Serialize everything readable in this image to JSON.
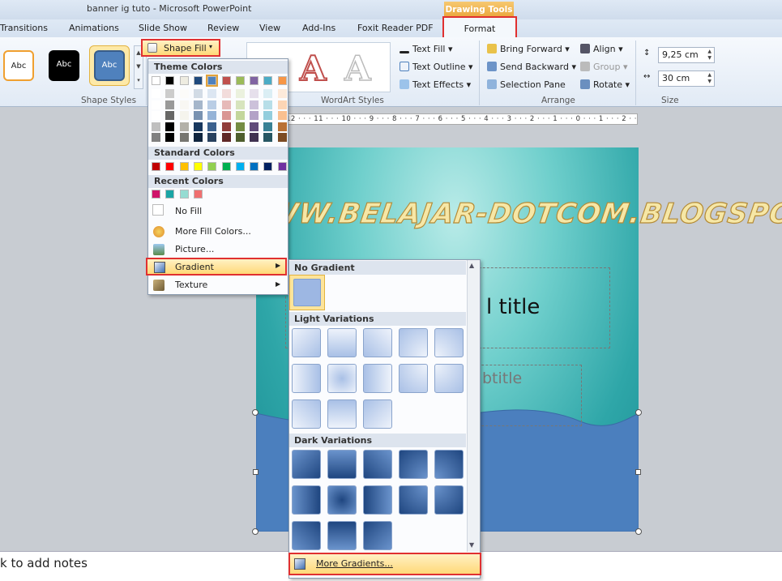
{
  "window": {
    "title": "banner ig tuto  -  Microsoft PowerPoint",
    "contextual_tab": "Drawing Tools"
  },
  "tabs": [
    "Transitions",
    "Animations",
    "Slide Show",
    "Review",
    "View",
    "Add-Ins",
    "Foxit Reader PDF",
    "Format"
  ],
  "ribbon": {
    "shape_styles": {
      "label": "Shape Styles",
      "thumbs": [
        "Abc",
        "Abc",
        "Abc"
      ],
      "shape_fill": "Shape Fill"
    },
    "wordart": {
      "label": "WordArt Styles",
      "text_fill": "Text Fill",
      "text_outline": "Text Outline",
      "text_effects": "Text Effects"
    },
    "arrange": {
      "label": "Arrange",
      "bring_forward": "Bring Forward",
      "send_backward": "Send Backward",
      "selection_pane": "Selection Pane",
      "align": "Align",
      "group": "Group",
      "rotate": "Rotate"
    },
    "size": {
      "label": "Size",
      "height": "9,25 cm",
      "width": "30 cm"
    }
  },
  "ruler": "12 · · · 11 · · · 10 · · · 9 · · · 8 · · · 7 · · · 6 · · · 5 · · · 4 · · · 3 · · · 2 · · · 1 · · · 0 · · · 1 · · · 2 · · · 3 · · · 4 · · · 5 · · · 6 · · · 7 · · · 8 · · · 9 · · · 10 · · · 11 · · · 12 · · · 13 · · · 14",
  "slide": {
    "title_fragment": "l title",
    "subtitle_fragment": "btitle",
    "watermark": "WWW.BELAJAR-DOTCOM.BLOGSPOT.COM"
  },
  "notes": "k to add notes",
  "shape_fill_menu": {
    "theme_colors": "Theme Colors",
    "standard_colors": "Standard Colors",
    "recent_colors": "Recent Colors",
    "no_fill": "No Fill",
    "more_fill_colors": "More Fill Colors...",
    "picture": "Picture...",
    "gradient": "Gradient",
    "texture": "Texture",
    "theme_top": [
      "#ffffff",
      "#000000",
      "#eeece1",
      "#1f497d",
      "#4f81bd",
      "#c0504d",
      "#9bbb59",
      "#8064a2",
      "#4bacc6",
      "#f79646"
    ],
    "standard": [
      "#c00000",
      "#ff0000",
      "#ffc000",
      "#ffff00",
      "#92d050",
      "#00b050",
      "#00b0f0",
      "#0070c0",
      "#002060",
      "#7030a0"
    ],
    "recent": [
      "#d0146a",
      "#1aa5a5",
      "#96dcd2",
      "#f07070"
    ]
  },
  "gradient_menu": {
    "no_gradient": "No Gradient",
    "light_variations": "Light Variations",
    "dark_variations": "Dark Variations",
    "more_gradients": "More Gradients..."
  },
  "colors": {
    "highlight": "#ffd978",
    "annotation": "#e03030",
    "slide_wave": "#4b7fbe"
  }
}
